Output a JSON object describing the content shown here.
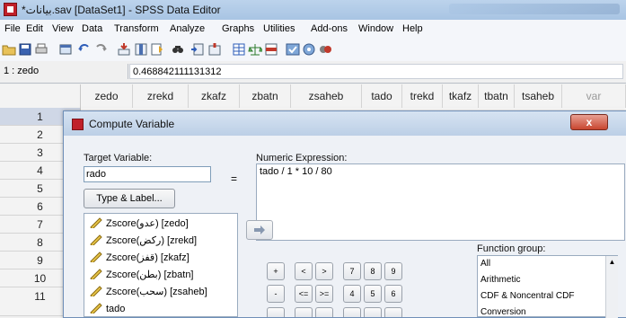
{
  "app": {
    "title": "*بيانات.sav [DataSet1] - SPSS Data Editor"
  },
  "menu": [
    "File",
    "Edit",
    "View",
    "Data",
    "Transform",
    "Analyze",
    "Graphs",
    "Utilities",
    "Add-ons",
    "Window",
    "Help"
  ],
  "toolbar": {
    "icons": [
      "open-icon",
      "save-icon",
      "print-icon",
      "dialog-recall-icon",
      "undo-icon",
      "redo-icon",
      "goto-case-icon",
      "goto-variable-icon",
      "variables-icon",
      "find-icon",
      "insert-cases-icon",
      "insert-variable-icon",
      "split-file-icon",
      "weight-cases-icon",
      "select-cases-icon",
      "value-labels-icon",
      "use-sets-icon",
      "show-sets-icon"
    ]
  },
  "cellref": {
    "name": "1 : zedo",
    "value": "0.468842111131312"
  },
  "grid": {
    "columns": [
      "zedo",
      "zrekd",
      "zkafz",
      "zbatn",
      "zsaheb",
      "tado",
      "trekd",
      "tkafz",
      "tbatn",
      "tsaheb",
      "var"
    ],
    "rows": [
      "1",
      "2",
      "3",
      "4",
      "5",
      "6",
      "7",
      "8",
      "9",
      "10",
      "11"
    ]
  },
  "dialog": {
    "title": "Compute Variable",
    "target_label": "Target Variable:",
    "target_value": "rado",
    "equals": "=",
    "type_label_button": "Type & Label...",
    "numeric_expression_label": "Numeric Expression:",
    "expression": "tado / 1 * 10 / 80",
    "close": "x",
    "variables": [
      "Zscore(عدو) [zedo]",
      "Zscore(ركض) [zrekd]",
      "Zscore(قفز) [zkafz]",
      "Zscore(بطن) [zbatn]",
      "Zscore(سحب) [zsaheb]",
      "tado"
    ],
    "keypad": [
      "+",
      "<",
      ">",
      "7",
      "8",
      "9",
      "-",
      "<=",
      ">=",
      "4",
      "5",
      "6"
    ],
    "function_group_label": "Function group:",
    "function_groups": [
      "All",
      "Arithmetic",
      "CDF & Noncentral CDF",
      "Conversion"
    ]
  }
}
